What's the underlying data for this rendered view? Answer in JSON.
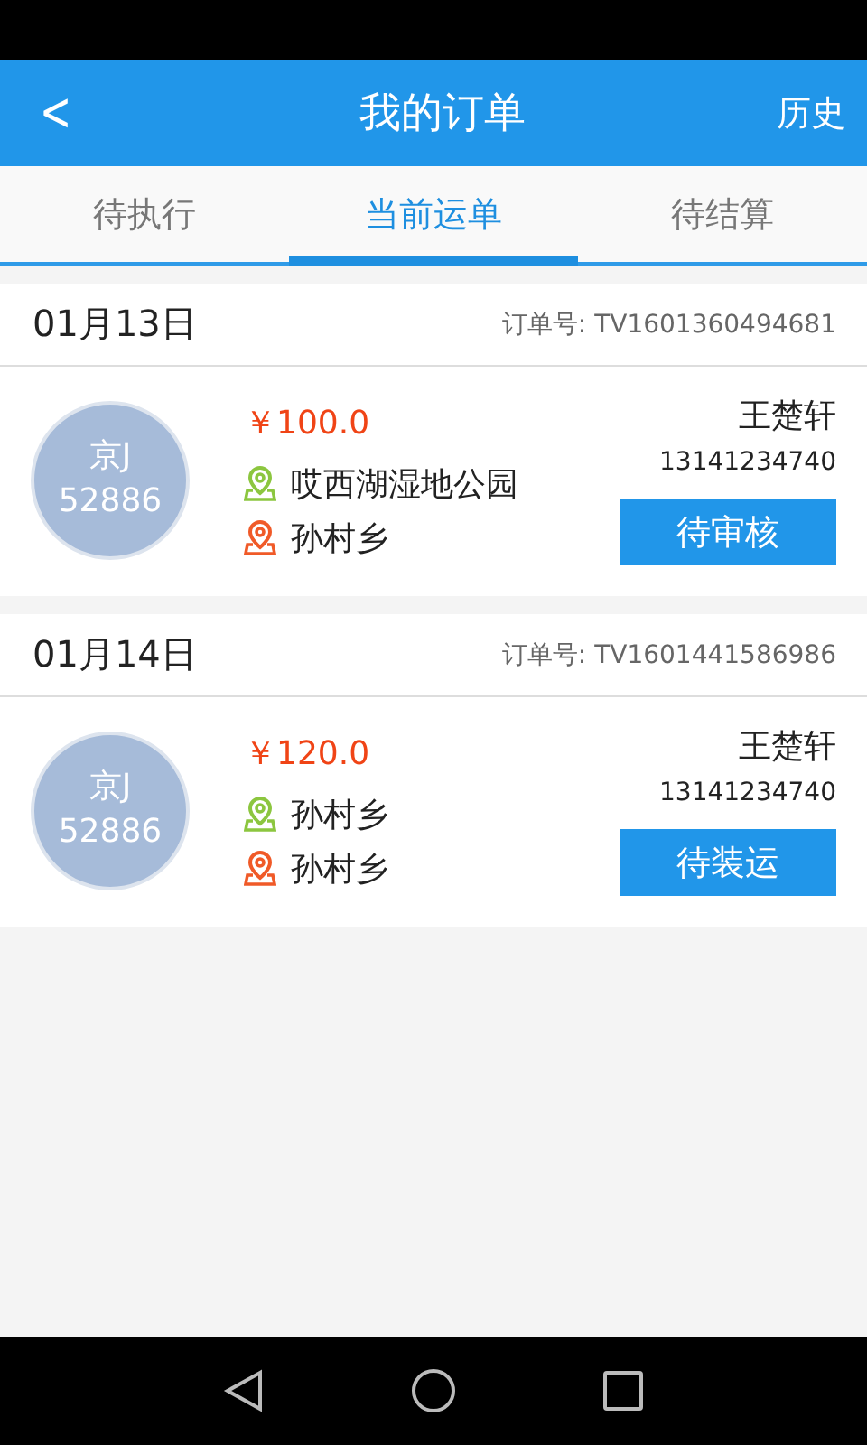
{
  "header": {
    "back": "<",
    "title": "我的订单",
    "action": "历史"
  },
  "tabs": [
    {
      "label": "待执行",
      "selected": false
    },
    {
      "label": "当前运单",
      "selected": true
    },
    {
      "label": "待结算",
      "selected": false
    }
  ],
  "orders": [
    {
      "date": "01月13日",
      "order_no_label": "订单号:",
      "order_no": "TV1601360494681",
      "plate_region": "京J",
      "plate_number": "52886",
      "price": "￥100.0",
      "stops": [
        {
          "kind": "from",
          "place": "哎西湖湿地公园"
        },
        {
          "kind": "to",
          "place": "孙村乡"
        }
      ],
      "contact_name": "王楚轩",
      "phone": "13141234740",
      "status": "待审核"
    },
    {
      "date": "01月14日",
      "order_no_label": "订单号:",
      "order_no": "TV1601441586986",
      "plate_region": "京J",
      "plate_number": "52886",
      "price": "￥120.0",
      "stops": [
        {
          "kind": "from",
          "place": "孙村乡"
        },
        {
          "kind": "to",
          "place": "孙村乡"
        }
      ],
      "contact_name": "王楚轩",
      "phone": "13141234740",
      "status": "待装运"
    }
  ]
}
